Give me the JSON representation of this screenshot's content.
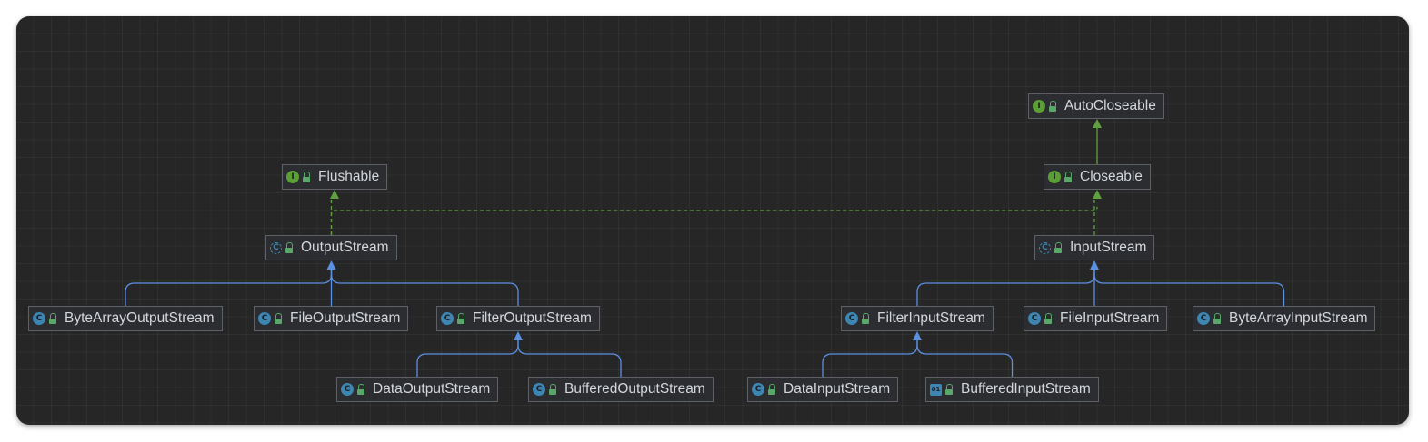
{
  "diagram": {
    "nodes": [
      {
        "id": "AutoCloseable",
        "label": "AutoCloseable",
        "kind": "interface",
        "icon": "interface-icon"
      },
      {
        "id": "Closeable",
        "label": "Closeable",
        "kind": "interface",
        "icon": "interface-icon"
      },
      {
        "id": "Flushable",
        "label": "Flushable",
        "kind": "interface",
        "icon": "interface-icon"
      },
      {
        "id": "OutputStream",
        "label": "OutputStream",
        "kind": "abstract",
        "icon": "abstract-class-icon"
      },
      {
        "id": "InputStream",
        "label": "InputStream",
        "kind": "abstract",
        "icon": "abstract-class-icon"
      },
      {
        "id": "ByteArrayOutputStream",
        "label": "ByteArrayOutputStream",
        "kind": "class",
        "icon": "class-icon"
      },
      {
        "id": "FileOutputStream",
        "label": "FileOutputStream",
        "kind": "class",
        "icon": "class-icon"
      },
      {
        "id": "FilterOutputStream",
        "label": "FilterOutputStream",
        "kind": "class",
        "icon": "class-icon"
      },
      {
        "id": "FilterInputStream",
        "label": "FilterInputStream",
        "kind": "class",
        "icon": "class-icon"
      },
      {
        "id": "FileInputStream",
        "label": "FileInputStream",
        "kind": "class",
        "icon": "class-icon"
      },
      {
        "id": "ByteArrayInputStream",
        "label": "ByteArrayInputStream",
        "kind": "class",
        "icon": "class-icon"
      },
      {
        "id": "DataOutputStream",
        "label": "DataOutputStream",
        "kind": "class",
        "icon": "class-icon"
      },
      {
        "id": "BufferedOutputStream",
        "label": "BufferedOutputStream",
        "kind": "class",
        "icon": "class-icon"
      },
      {
        "id": "DataInputStream",
        "label": "DataInputStream",
        "kind": "class",
        "icon": "class-icon"
      },
      {
        "id": "BufferedInputStream",
        "label": "BufferedInputStream",
        "kind": "compiled-class",
        "icon": "binary-class-icon"
      }
    ],
    "edges": [
      {
        "from": "Closeable",
        "to": "AutoCloseable",
        "type": "extends-interface"
      },
      {
        "from": "OutputStream",
        "to": "Flushable",
        "type": "implements"
      },
      {
        "from": "OutputStream",
        "to": "Closeable",
        "type": "implements"
      },
      {
        "from": "InputStream",
        "to": "Closeable",
        "type": "implements"
      },
      {
        "from": "ByteArrayOutputStream",
        "to": "OutputStream",
        "type": "extends"
      },
      {
        "from": "FileOutputStream",
        "to": "OutputStream",
        "type": "extends"
      },
      {
        "from": "FilterOutputStream",
        "to": "OutputStream",
        "type": "extends"
      },
      {
        "from": "DataOutputStream",
        "to": "FilterOutputStream",
        "type": "extends"
      },
      {
        "from": "BufferedOutputStream",
        "to": "FilterOutputStream",
        "type": "extends"
      },
      {
        "from": "FilterInputStream",
        "to": "InputStream",
        "type": "extends"
      },
      {
        "from": "FileInputStream",
        "to": "InputStream",
        "type": "extends"
      },
      {
        "from": "ByteArrayInputStream",
        "to": "InputStream",
        "type": "extends"
      },
      {
        "from": "DataInputStream",
        "to": "FilterInputStream",
        "type": "extends"
      },
      {
        "from": "BufferedInputStream",
        "to": "FilterInputStream",
        "type": "extends"
      }
    ],
    "colors": {
      "background": "#262626",
      "node_fill": "#2b2d30",
      "node_border": "#5d6066",
      "text": "#d3d6db",
      "extends_edge": "#5b8fe0",
      "interface_edge": "#5fa040",
      "class_badge": "#3d86b3",
      "interface_badge": "#5a9e36",
      "lock": "#59a869"
    }
  }
}
